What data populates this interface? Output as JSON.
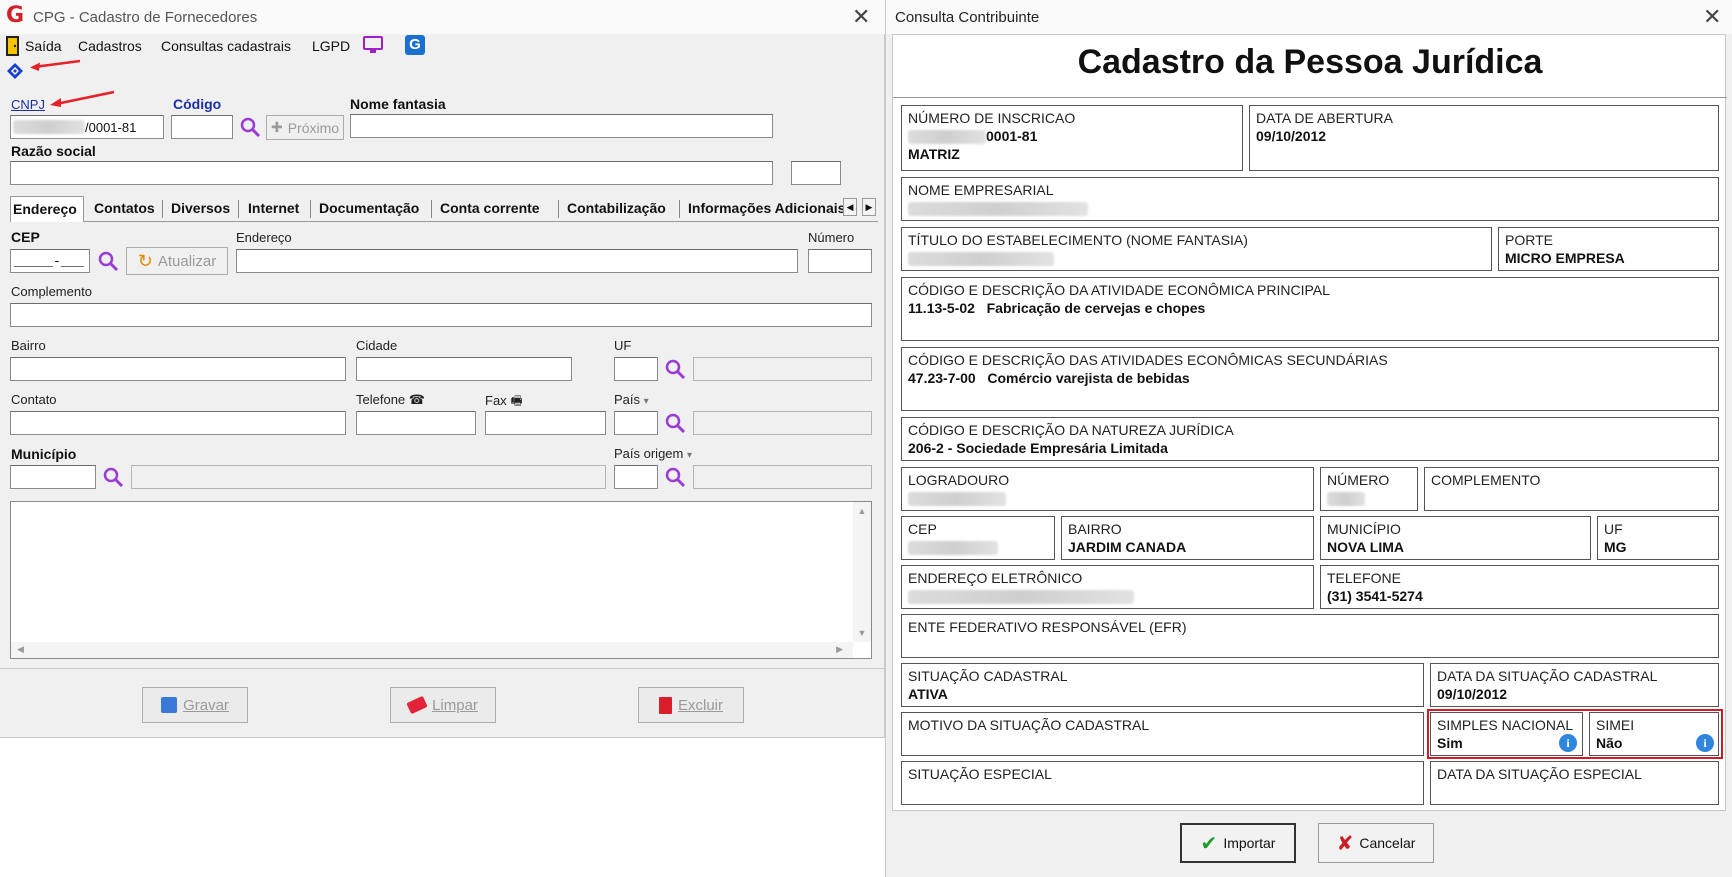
{
  "left_window": {
    "title": "CPG - Cadastro de Fornecedores",
    "close_glyph": "✕",
    "menu": [
      "Saída",
      "Cadastros",
      "Consultas cadastrais",
      "LGPD"
    ],
    "fields": {
      "cnpj_link": "CNPJ",
      "cnpj_value": "/0001-81",
      "codigo_label": "Código",
      "proximo_button": "Próximo",
      "nome_fantasia_label": "Nome fantasia",
      "razao_social_label": "Razão social"
    },
    "tabs": [
      "Endereço",
      "Contatos",
      "Diversos",
      "Internet",
      "Documentação",
      "Conta corrente",
      "Contabilização",
      "Informações Adicionais"
    ],
    "address": {
      "cep_label": "CEP",
      "cep_placeholder": "_____-___",
      "atualizar_button": "Atualizar",
      "endereco_label": "Endereço",
      "numero_label": "Número",
      "complemento_label": "Complemento",
      "bairro_label": "Bairro",
      "cidade_label": "Cidade",
      "uf_label": "UF",
      "contato_label": "Contato",
      "telefone_label": "Telefone",
      "fax_label": "Fax",
      "pais_label": "País",
      "municipio_label": "Município",
      "pais_origem_label": "País origem"
    },
    "buttons": {
      "gravar": "Gravar",
      "limpar": "Limpar",
      "excluir": "Excluir"
    }
  },
  "right_window": {
    "title": "Consulta Contribuinte",
    "close_glyph": "✕",
    "heading": "Cadastro da Pessoa Jurídica",
    "cells": {
      "numero_inscricao_label": "NÚMERO DE INSCRICAO",
      "numero_inscricao_value": "0001-81",
      "matriz": "MATRIZ",
      "data_abertura_label": "DATA DE ABERTURA",
      "data_abertura_value": "09/10/2012",
      "nome_empresarial_label": "NOME EMPRESARIAL",
      "titulo_label": "TÍTULO DO ESTABELECIMENTO (NOME FANTASIA)",
      "porte_label": "PORTE",
      "porte_value": "MICRO EMPRESA",
      "atividade_principal_label": "CÓDIGO E DESCRIÇÃO DA ATIVIDADE ECONÔMICA PRINCIPAL",
      "atividade_principal_value": "11.13-5-02   Fabricação de cervejas e chopes",
      "atividades_secundarias_label": "CÓDIGO E DESCRIÇÃO DAS ATIVIDADES ECONÔMICAS SECUNDÁRIAS",
      "atividades_secundarias_value": "47.23-7-00   Comércio varejista de bebidas",
      "natureza_juridica_label": "CÓDIGO E DESCRIÇÃO DA NATUREZA JURÍDICA",
      "natureza_juridica_value": "206-2 - Sociedade Empresária Limitada",
      "logradouro_label": "LOGRADOURO",
      "numero_label": "NÚMERO",
      "complemento_label": "COMPLEMENTO",
      "cep_label": "CEP",
      "bairro_label": "BAIRRO",
      "bairro_value": "JARDIM CANADA",
      "municipio_label": "MUNICÍPIO",
      "municipio_value": "NOVA LIMA",
      "uf_label": "UF",
      "uf_value": "MG",
      "email_label": "ENDEREÇO ELETRÔNICO",
      "telefone_label": "TELEFONE",
      "telefone_value": "(31) 3541-5274",
      "efr_label": "ENTE FEDERATIVO RESPONSÁVEL (EFR)",
      "situacao_label": "SITUAÇÃO CADASTRAL",
      "situacao_value": "ATIVA",
      "data_situacao_label": "DATA DA SITUAÇÃO CADASTRAL",
      "data_situacao_value": "09/10/2012",
      "motivo_label": "MOTIVO DA SITUAÇÃO CADASTRAL",
      "simples_label": "SIMPLES NACIONAL",
      "simples_value": "Sim",
      "simei_label": "SIMEI",
      "simei_value": "Não",
      "situacao_especial_label": "SITUAÇÃO ESPECIAL",
      "data_situacao_especial_label": "DATA DA SITUAÇÃO ESPECIAL"
    },
    "buttons": {
      "importar": "Importar",
      "cancelar": "Cancelar"
    }
  },
  "colors": {
    "link_blue": "#1a2fa8",
    "highlight_red": "#d11a2a",
    "annotation_arrow": "#e8202a",
    "info_blue": "#2e86de",
    "search_purple": "#9b3bd6"
  }
}
